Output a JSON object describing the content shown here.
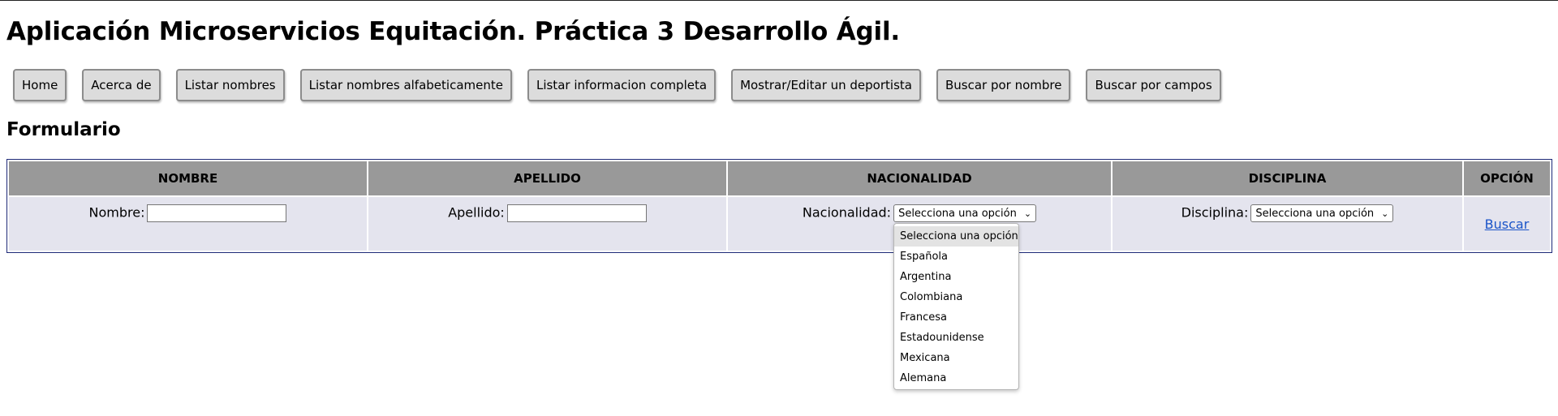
{
  "header": {
    "title": "Aplicación Microservicios Equitación. Práctica 3 Desarrollo Ágil."
  },
  "nav": {
    "home": "Home",
    "about": "Acerca de",
    "list_names": "Listar nombres",
    "list_names_alpha": "Listar nombres alfabeticamente",
    "list_full_info": "Listar informacion completa",
    "show_edit_athlete": "Mostrar/Editar un deportista",
    "search_by_name": "Buscar por nombre",
    "search_by_fields": "Buscar por campos"
  },
  "form": {
    "title": "Formulario",
    "columns": [
      "NOMBRE",
      "APELLIDO",
      "NACIONALIDAD",
      "DISCIPLINA",
      "OPCIÓN"
    ],
    "nombre_label": "Nombre:",
    "nombre_value": "",
    "apellido_label": "Apellido:",
    "apellido_value": "",
    "nacionalidad_label": "Nacionalidad:",
    "nacionalidad_selected": "Selecciona una opción",
    "disciplina_label": "Disciplina:",
    "disciplina_selected": "Selecciona una opción",
    "search_link": "Buscar"
  },
  "nationality_dropdown": {
    "options": [
      "Selecciona una opción",
      "Española",
      "Argentina",
      "Colombiana",
      "Francesa",
      "Estadounidense",
      "Mexicana",
      "Alemana"
    ]
  },
  "icons": {
    "select_arrow": "chevron-down-icon"
  },
  "colors": {
    "button_bg": "#dcdcdc",
    "table_header_bg": "#999999",
    "table_cell_bg": "#e4e4ee",
    "table_border": "#1e2a78",
    "link": "#1a54c8"
  }
}
